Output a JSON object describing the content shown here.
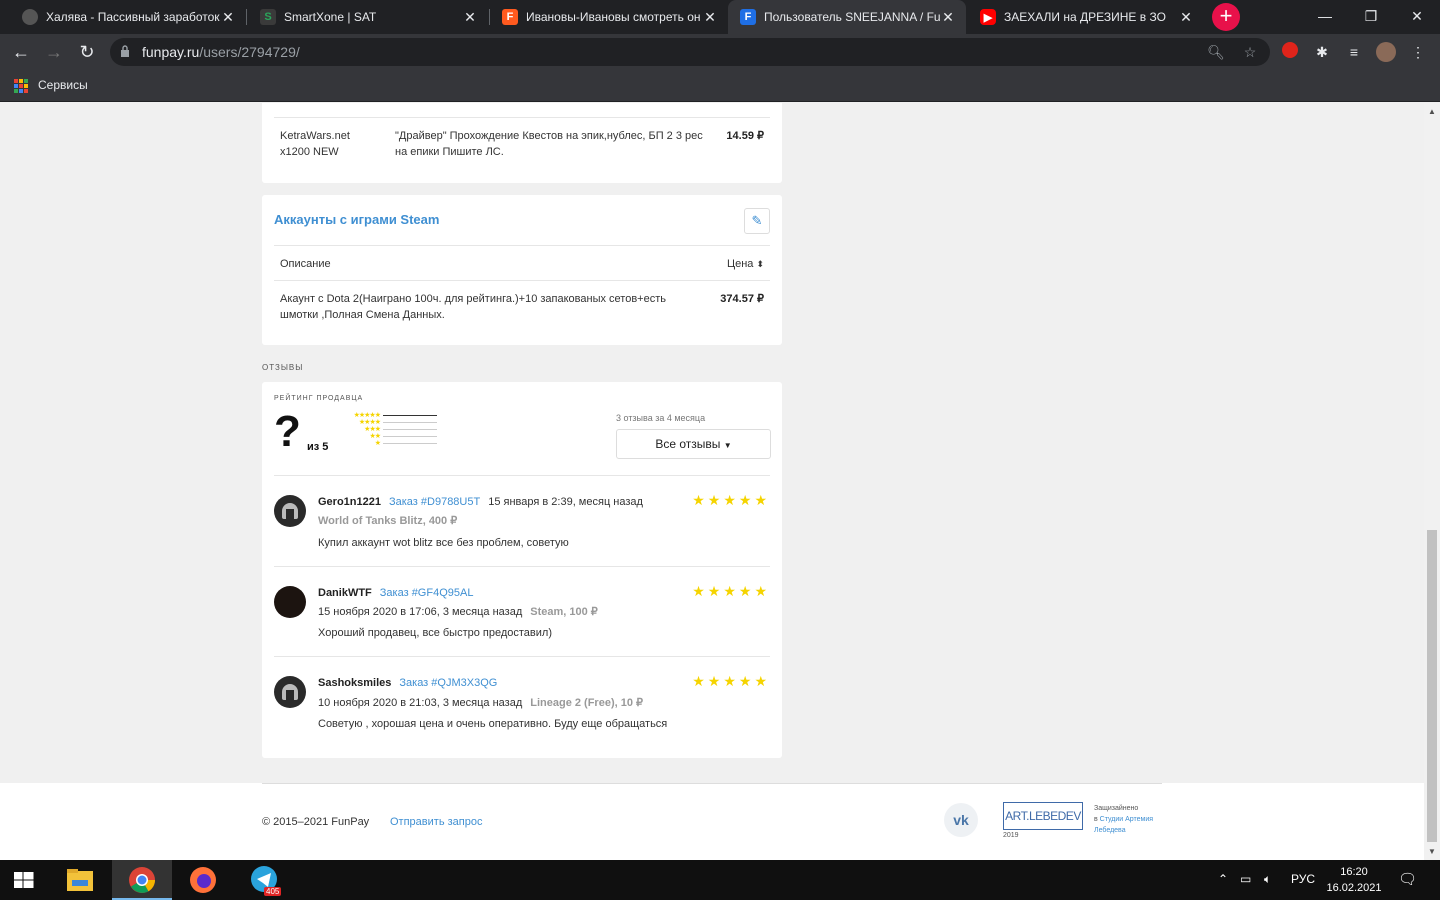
{
  "tabs": [
    {
      "title": "Халява - Пассивный заработок",
      "active": false
    },
    {
      "title": "SmartXone | SAT",
      "active": false
    },
    {
      "title": "Ивановы-Ивановы смотреть он",
      "active": false
    },
    {
      "title": "Пользователь SNEEJANNA / Fun",
      "active": true
    },
    {
      "title": "ЗАЕХАЛИ на ДРЕЗИНЕ в ЗО",
      "active": false
    }
  ],
  "address": {
    "host": "funpay.ru",
    "path": "/users/2794729/"
  },
  "bookmarks": {
    "apps_label": "Сервисы"
  },
  "top_offer": {
    "server": "KetraWars.net x1200 NEW",
    "description": "\"Драйвер\" Прохождение Квестов на эпик,нублес, БП 2 3 рес на епики Пишите ЛС.",
    "price": "14.59 ₽"
  },
  "steam_section": {
    "title": "Аккаунты с играми Steam",
    "col_description": "Описание",
    "col_price": "Цена",
    "offers": [
      {
        "description": "Акаунт с Dota 2(Наиграно 100ч. для рейтинга.)+10 запакованых сетов+есть шмотки ,Полная Смена Данных.",
        "price": "374.57 ₽"
      }
    ]
  },
  "reviews_section": {
    "heading": "отзывы",
    "rating_label": "рейтинг продавца",
    "rating_value": "?",
    "rating_of": "из 5",
    "count_text": "3 отзыва за 4 месяца",
    "all_button": "Все отзывы",
    "reviews": [
      {
        "user": "Gero1n1221",
        "order": "Заказ #D9788U5T",
        "date": "15 января в 2:39, месяц назад",
        "game": "World of Tanks Blitz, 400 ₽",
        "text": "Купил аккаунт wot blitz все без проблем, советую",
        "stars": 5
      },
      {
        "user": "DanikWTF",
        "order": "Заказ #GF4Q95AL",
        "date": "15 ноября 2020 в 17:06, 3 месяца назад",
        "game": "Steam, 100 ₽",
        "text": "Хороший продавец, все быстро предоставил)",
        "stars": 5
      },
      {
        "user": "Sashoksmiles",
        "order": "Заказ #QJM3X3QG",
        "date": "10 ноября 2020 в 21:03, 3 месяца назад",
        "game": "Lineage 2 (Free), 10 ₽",
        "text": "Советую , хорошая цена и очень оперативно. Буду еще обращаться",
        "stars": 5
      }
    ]
  },
  "footer": {
    "copyright": "© 2015–2021 FunPay",
    "send_request": "Отправить запрос",
    "vk": "vk",
    "artlebedev": "ART.LEBEDEV",
    "artlebedev_year": "2019",
    "protected_text": "Защизайнено",
    "protected_in": "в",
    "protected_link": "Студии Артемия Лебедева"
  },
  "taskbar": {
    "language": "РУС",
    "time": "16:20",
    "date": "16.02.2021",
    "telegram_badge": "405"
  },
  "colors": {
    "link": "#3f8fd2",
    "star": "#f5d400",
    "accent_newtab": "#e8114a"
  }
}
